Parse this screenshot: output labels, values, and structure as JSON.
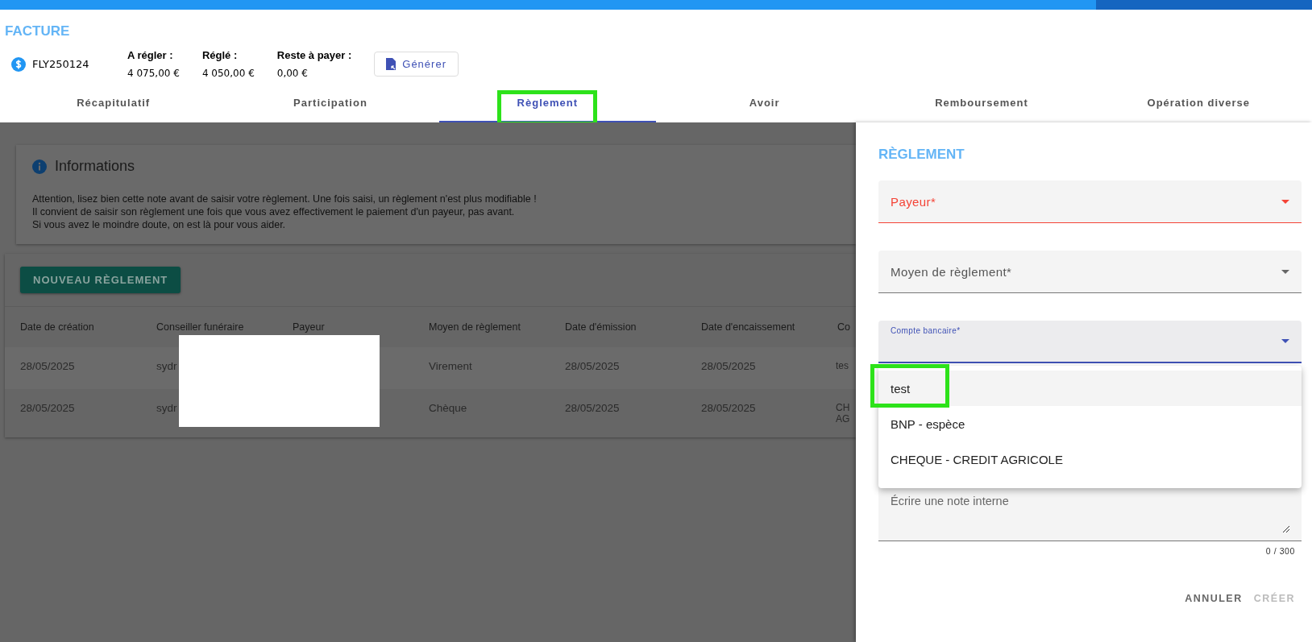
{
  "header": {
    "title": "FACTURE",
    "invoice_number": "FLY250124",
    "amounts": [
      {
        "label": "A régler :",
        "value": "4 075,00 €"
      },
      {
        "label": "Réglé :",
        "value": "4 050,00 €"
      },
      {
        "label": "Reste à payer :",
        "value": "0,00 €"
      }
    ],
    "generate_button": "Générer"
  },
  "tabs": [
    {
      "label": "Récapitulatif",
      "selected": false,
      "highlighted": false
    },
    {
      "label": "Participation",
      "selected": false,
      "highlighted": false
    },
    {
      "label": "Règlement",
      "selected": true,
      "highlighted": true
    },
    {
      "label": "Avoir",
      "selected": false,
      "highlighted": false
    },
    {
      "label": "Remboursement",
      "selected": false,
      "highlighted": false
    },
    {
      "label": "Opération diverse",
      "selected": false,
      "highlighted": false
    }
  ],
  "info": {
    "title": "Informations",
    "lines": [
      "Attention, lisez bien cette note avant de saisir votre règlement. Une fois saisi, un règlement n'est plus modifiable !",
      "Il convient de saisir son règlement une fois que vous avez effectivement le paiement d'un payeur, pas avant.",
      "Si vous avez le moindre doute, on est là pour vous aider."
    ]
  },
  "new_button": "NOUVEAU RÈGLEMENT",
  "table": {
    "columns": [
      "Date de création",
      "Conseiller funéraire",
      "Payeur",
      "Moyen de règlement",
      "Date d'émission",
      "Date d'encaissement",
      "Co"
    ],
    "rows": [
      [
        "28/05/2025",
        "sydr",
        "",
        "Virement",
        "28/05/2025",
        "28/05/2025",
        "tes"
      ],
      [
        "28/05/2025",
        "sydr",
        "",
        "Chèque",
        "28/05/2025",
        "28/05/2025",
        "CH AG"
      ]
    ]
  },
  "drawer": {
    "title": "RÈGLEMENT",
    "fields": [
      {
        "label": "Payeur*",
        "error": true,
        "focused": false
      },
      {
        "label": "Moyen de règlement*",
        "error": false,
        "focused": false
      },
      {
        "label": "Compte bancaire*",
        "error": false,
        "focused": true
      }
    ],
    "menu": [
      {
        "label": "test",
        "selected": true,
        "highlighted": true
      },
      {
        "label": "BNP - espèce",
        "selected": false,
        "highlighted": false
      },
      {
        "label": "CHEQUE - CREDIT AGRICOLE",
        "selected": false,
        "highlighted": false
      }
    ],
    "note": {
      "placeholder": "Écrire une note interne",
      "counter": "0 / 300"
    },
    "actions": [
      {
        "label": "ANNULER",
        "disabled": false
      },
      {
        "label": "CRÉER",
        "disabled": true
      }
    ]
  }
}
